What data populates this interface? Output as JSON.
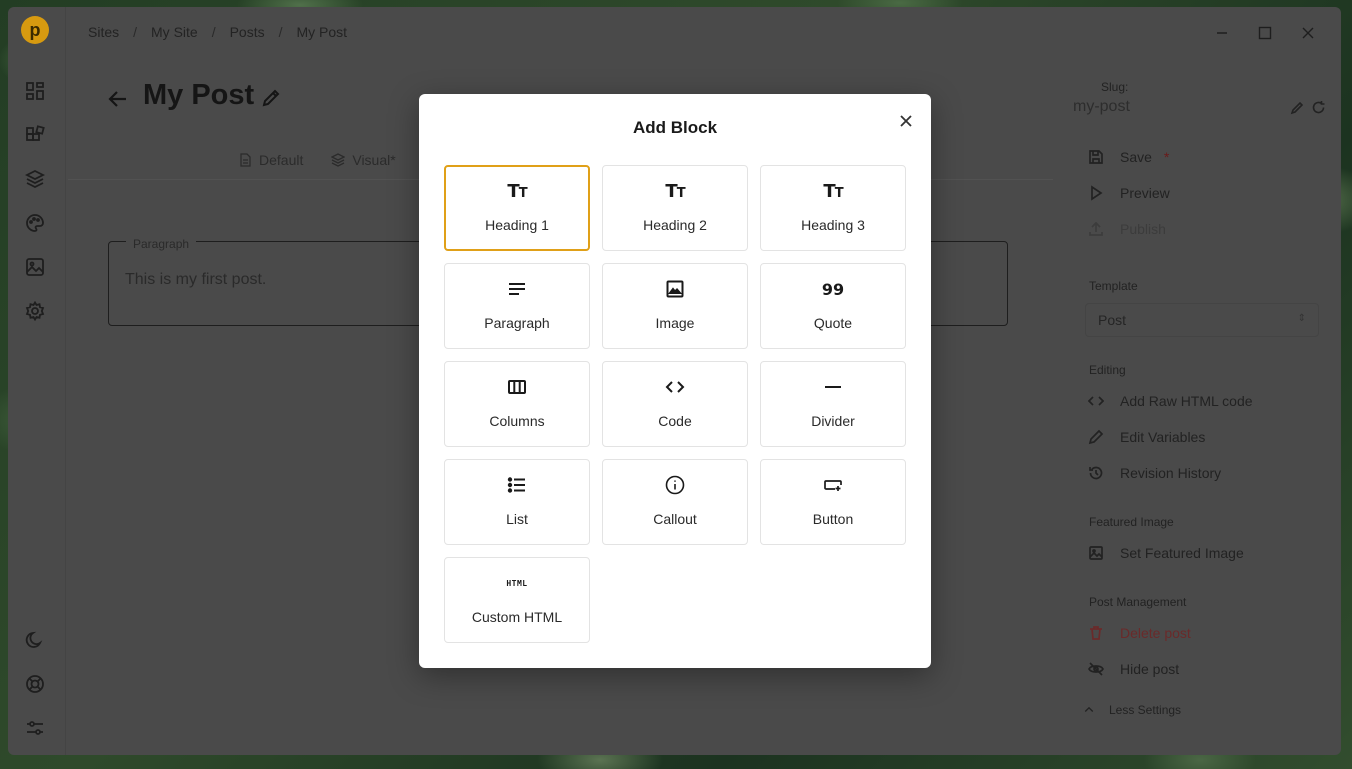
{
  "breadcrumb": [
    "Sites",
    "My Site",
    "Posts",
    "My Post"
  ],
  "logo_letter": "p",
  "post": {
    "title": "My Post",
    "tabs": [
      "Default",
      "Visual*"
    ],
    "paragraph_legend": "Paragraph",
    "paragraph_text": "This is my first post."
  },
  "sidebar_right": {
    "slug_label": "Slug:",
    "slug_value": "my-post",
    "save_label": "Save",
    "save_required": "*",
    "preview_label": "Preview",
    "publish_label": "Publish",
    "template_label": "Template",
    "template_value": "Post",
    "editing_label": "Editing",
    "raw_html_label": "Add Raw HTML code",
    "edit_variables_label": "Edit Variables",
    "revision_history_label": "Revision History",
    "featured_image_label": "Featured Image",
    "set_featured_image_label": "Set Featured Image",
    "post_management_label": "Post Management",
    "delete_post_label": "Delete post",
    "hide_post_label": "Hide post",
    "less_settings_label": "Less Settings"
  },
  "modal": {
    "title": "Add Block",
    "blocks": [
      {
        "label": "Heading 1",
        "icon": "heading-icon",
        "selected": true
      },
      {
        "label": "Heading 2",
        "icon": "heading-icon"
      },
      {
        "label": "Heading 3",
        "icon": "heading-icon"
      },
      {
        "label": "Paragraph",
        "icon": "paragraph-icon"
      },
      {
        "label": "Image",
        "icon": "image-icon"
      },
      {
        "label": "Quote",
        "icon": "quote-icon"
      },
      {
        "label": "Columns",
        "icon": "columns-icon"
      },
      {
        "label": "Code",
        "icon": "code-icon"
      },
      {
        "label": "Divider",
        "icon": "divider-icon"
      },
      {
        "label": "List",
        "icon": "list-icon"
      },
      {
        "label": "Callout",
        "icon": "info-icon"
      },
      {
        "label": "Button",
        "icon": "button-icon"
      },
      {
        "label": "Custom HTML",
        "icon": "html-icon"
      }
    ],
    "icon_text": {
      "heading": "T",
      "heading_small": "T",
      "quote": "99",
      "html": "HTML"
    }
  },
  "colors": {
    "accent": "#e0a018",
    "overlay": "#4a4a4a"
  }
}
